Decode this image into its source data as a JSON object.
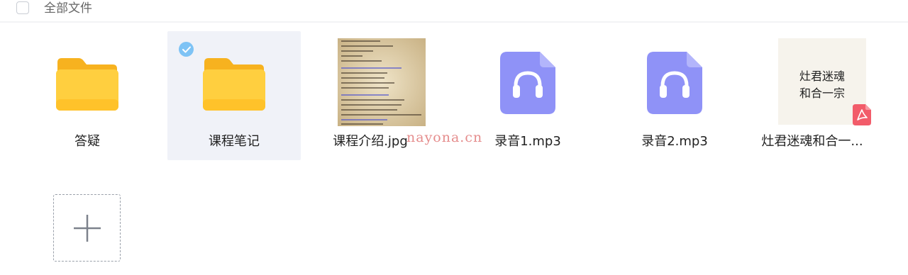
{
  "header": {
    "title": "全部文件"
  },
  "files": [
    {
      "name": "答疑",
      "type": "folder",
      "selected": false
    },
    {
      "name": "课程笔记",
      "type": "folder",
      "selected": true
    },
    {
      "name": "课程介绍.jpg",
      "type": "image"
    },
    {
      "name": "录音1.mp3",
      "type": "audio"
    },
    {
      "name": "录音2.mp3",
      "type": "audio"
    },
    {
      "name": "灶君迷魂和合一...",
      "type": "pdf",
      "thumb_lines": [
        "灶君迷魂",
        "和合一宗"
      ]
    }
  ],
  "watermark": "nayona.cn",
  "colors": {
    "folder": "#ffc93a",
    "audio": "#8f92f7",
    "selected_bg": "#f0f2f8",
    "check": "#7ec3f5",
    "pdf": "#f25c6a"
  }
}
